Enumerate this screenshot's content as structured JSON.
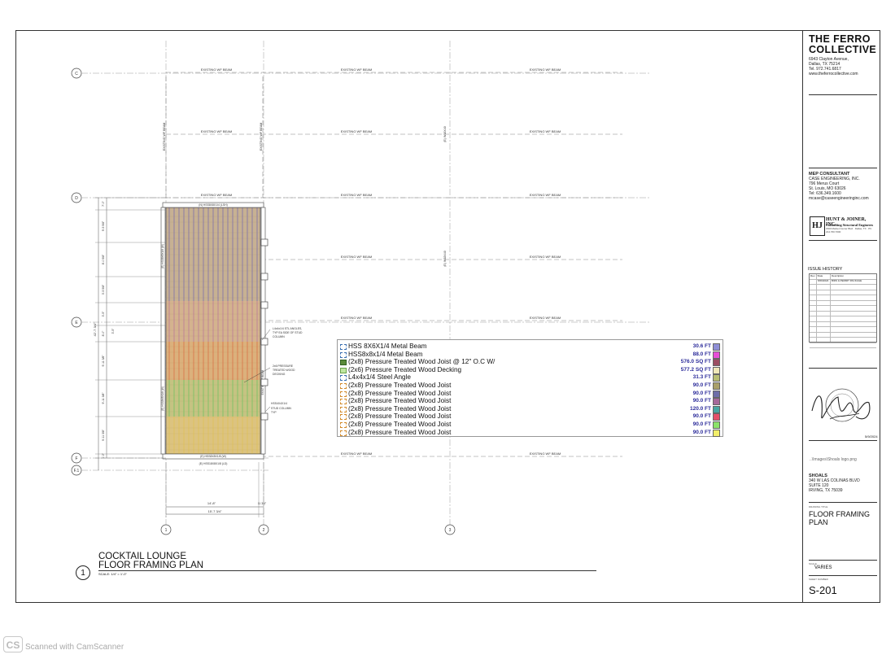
{
  "drawing": {
    "grid_rows": [
      "C",
      "D",
      "E",
      "F",
      "F.1"
    ],
    "grid_cols": [
      "1",
      "2",
      "3"
    ],
    "existing_beam_label": "EXISTING WF BEAM",
    "beam_top_label": "(N) HSS8X8X1/4 (LSH)",
    "beam_bottom_label_1": "(E) HSS8X8X1/8 (W)",
    "beam_bottom_label_2": "(E) HSS18X8X1/8 (LD)",
    "left_beam_label_1": "(E) HSS8X8X1/8 (W)",
    "left_beam_label_2": "(E) HSS8X8X1/8 (W)",
    "right_beam_label": "EXISTING WF BEAM",
    "col3_label": "(E) W18X40",
    "callout_angles": "L4x4x1/4 STL ANGLES, TYP EA SIDE OF STUD COLUMN",
    "callout_decking": "2x6 PRESSURE TREATED WOOD DECKING",
    "callout_stud": "HSS4X4X1/4 STUD COLUMN TYP",
    "dim_overall": "42'-7 3/4\"",
    "dims_left": [
      "7'-0\"",
      "9'-5 5/8\"",
      "8'-0 5/8\"",
      "3'-5 5/8\"",
      "3'-5\"",
      "8'-0\"",
      "9'-11 3/8\"",
      "9'-11 3/8\"",
      "9'-11 3/8\"",
      "1'-0\""
    ],
    "dim_width": "14'-8\"",
    "dim_flange": "11 3/4\"",
    "dim_total_width": "15'-7 3/4\""
  },
  "legend": [
    {
      "label": "HSS 8X6X1/4 Metal Beam",
      "value": "30.6 FT",
      "color": "#8e8ed6",
      "icon": "beam-icon"
    },
    {
      "label": "HSS8x8x1/4 Metal Beam",
      "value": "88.0 FT",
      "color": "#e64fd8",
      "icon": "beam-icon"
    },
    {
      "label": "(2x8) Pressure Treated Wood Joist @ 12\" O.C W/",
      "value": "576.0 SQ FT",
      "color": "#9b4e62",
      "icon": "joist-area-icon"
    },
    {
      "label": "(2x6) Pressure Treated Wood Decking",
      "value": "577.2 SQ FT",
      "color": "#f0e8b8",
      "icon": "decking-area-icon"
    },
    {
      "label": "L4x4x1/4 Steel Angle",
      "value": "31.3 FT",
      "color": "#b7bd72",
      "icon": "angle-icon"
    },
    {
      "label": "(2x8) Pressure Treated Wood Joist",
      "value": "90.0 FT",
      "color": "#a9a06a",
      "icon": "joist-icon"
    },
    {
      "label": "(2x8) Pressure Treated Wood Joist",
      "value": "90.0 FT",
      "color": "#6e6ea8",
      "icon": "joist-icon"
    },
    {
      "label": "(2x8) Pressure Treated Wood Joist",
      "value": "90.0 FT",
      "color": "#a6699a",
      "icon": "joist-icon"
    },
    {
      "label": "(2x8) Pressure Treated Wood Joist",
      "value": "120.0 FT",
      "color": "#47a7a3",
      "icon": "joist-icon"
    },
    {
      "label": "(2x8) Pressure Treated Wood Joist",
      "value": "90.0 FT",
      "color": "#e5506a",
      "icon": "joist-icon"
    },
    {
      "label": "(2x8) Pressure Treated Wood Joist",
      "value": "90.0 FT",
      "color": "#8be36a",
      "icon": "joist-icon"
    },
    {
      "label": "(2x8) Pressure Treated Wood Joist",
      "value": "90.0 FT",
      "color": "#f2ee6a",
      "icon": "joist-icon"
    }
  ],
  "plan_title_1": "COCKTAIL LOUNGE",
  "plan_title_2": "FLOOR FRAMING PLAN",
  "plan_number": "1",
  "plan_scale": "SCALE: 1/4\" = 1'-0\"",
  "titleblock": {
    "firm_line1": "THE FERRO",
    "firm_line2": "COLLECTIVE",
    "firm_address": [
      "6943 Clayton Avenue,",
      "Dallas, TX 75214",
      "Tel. 972.741.6817",
      "www.theferrocollective.com"
    ],
    "mep_head": "MEP CONSULTANT",
    "mep_lines": [
      "CASE ENGINEERING, INC.",
      "796 Merus Court",
      "St. Louis, MO 63026",
      "Tel: 636.349.1600",
      "mcase@caseengineeringinc.com"
    ],
    "hj_mark": "HJ",
    "hj_name": "HUNT & JOINER, INC.",
    "hj_sub": "Consulting Structural Engineers",
    "hj_fine": "1500 Market Center Blvd · Dallas, TX · Ph: 214.760.7000",
    "issue_title": "ISSUE HISTORY",
    "issue_headers": [
      "Rev. #",
      "Date",
      "Description"
    ],
    "issue_row1": [
      "",
      "5/09/2024",
      "BIDS & PERMIT PACKAGE"
    ],
    "seal_date": "5/9/2024",
    "image_placeholder": "..\\Images\\Shoals logo.png",
    "client_head": "SHOALS",
    "client_lines": [
      "340 W LAS COLINAS BLVD",
      "SUITE 120",
      "IRVING, TX 75039"
    ],
    "drawing_title_label": "DRAWING TITLE",
    "drawing_title_1": "FLOOR FRAMING",
    "drawing_title_2": "PLAN",
    "scale_label": "SCALE",
    "scale_value": "VARIES",
    "sheet_label": "SHEET NUMBER",
    "sheet_number": "S-201"
  },
  "scanner": {
    "mark": "CS",
    "text": "Scanned with CamScanner"
  }
}
